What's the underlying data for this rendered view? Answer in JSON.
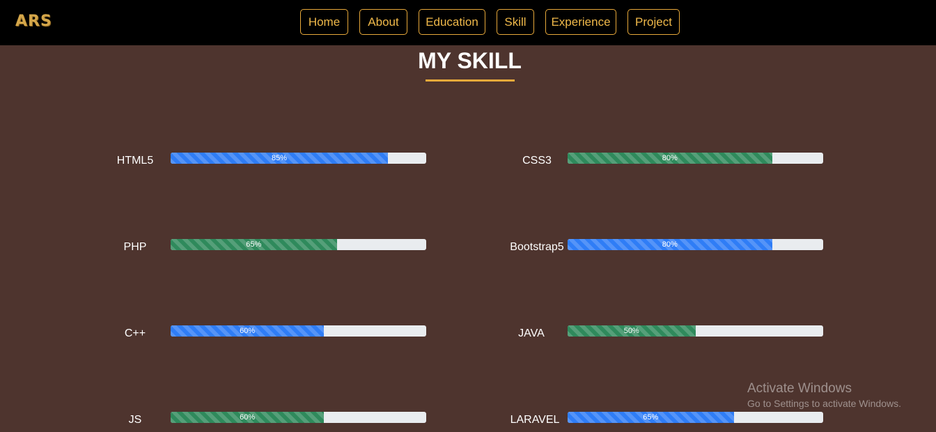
{
  "brand": {
    "logo_text": "ARS"
  },
  "nav": {
    "items": [
      {
        "label": "Home"
      },
      {
        "label": "About"
      },
      {
        "label": "Education"
      },
      {
        "label": "Skill"
      },
      {
        "label": "Experience"
      },
      {
        "label": "Project"
      }
    ]
  },
  "section": {
    "title": "MY SKILL"
  },
  "skills": [
    {
      "name": "HTML5",
      "percent_label": "85%",
      "value": 85,
      "color": "blue"
    },
    {
      "name": "CSS3",
      "percent_label": "80%",
      "value": 80,
      "color": "green"
    },
    {
      "name": "PHP",
      "percent_label": "65%",
      "value": 65,
      "color": "green"
    },
    {
      "name": "Bootstrap5",
      "percent_label": "80%",
      "value": 80,
      "color": "blue"
    },
    {
      "name": "C++",
      "percent_label": "60%",
      "value": 60,
      "color": "blue"
    },
    {
      "name": "JAVA",
      "percent_label": "50%",
      "value": 50,
      "color": "green"
    },
    {
      "name": "JS",
      "percent_label": "60%",
      "value": 60,
      "color": "green"
    },
    {
      "name": "LARAVEL",
      "percent_label": "65%",
      "value": 65,
      "color": "blue"
    }
  ],
  "watermark": {
    "line1": "Activate Windows",
    "line2": "Go to Settings to activate Windows."
  },
  "colors": {
    "background": "#4e342e",
    "nav_background": "#000000",
    "accent": "#e8a93a",
    "bar_blue": "#2f7df6",
    "bar_green": "#2f8a5c",
    "track": "#e9ecef"
  }
}
